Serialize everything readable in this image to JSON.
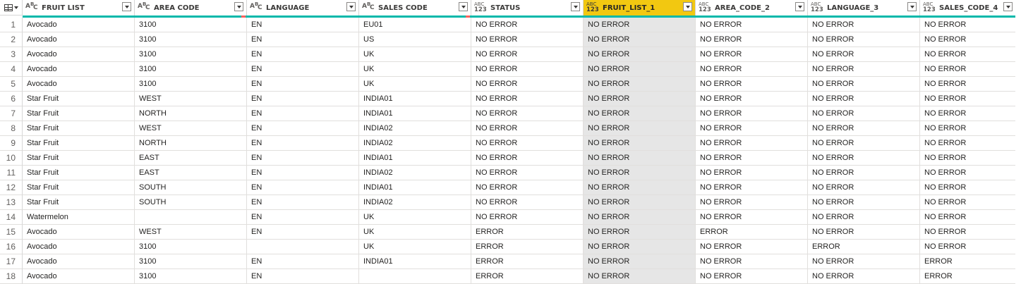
{
  "columns": [
    {
      "name": "FRUIT LIST",
      "type": "abc"
    },
    {
      "name": "AREA CODE",
      "type": "abc"
    },
    {
      "name": "LANGUAGE",
      "type": "abc"
    },
    {
      "name": "SALES CODE",
      "type": "abc"
    },
    {
      "name": "STATUS",
      "type": "any"
    },
    {
      "name": "FRUIT_LIST_1",
      "type": "any",
      "selected": true
    },
    {
      "name": "AREA_CODE_2",
      "type": "any"
    },
    {
      "name": "LANGUAGE_3",
      "type": "any"
    },
    {
      "name": "SALES_CODE_4",
      "type": "any"
    }
  ],
  "type_icons": {
    "abc": [
      "A",
      "B",
      "C"
    ],
    "any": [
      "ABC",
      "123"
    ]
  },
  "quality_error_columns": [
    1,
    3
  ],
  "colors": {
    "quality_bar": "#01b8aa",
    "quality_error": "#fd625e",
    "selected_header": "#f2c811",
    "selected_column": "#e6e6e6"
  },
  "rows": [
    {
      "num": "1",
      "cells": [
        "Avocado",
        "3100",
        "EN",
        "EU01",
        "NO ERROR",
        "NO ERROR",
        "NO ERROR",
        "NO ERROR",
        "NO ERROR"
      ]
    },
    {
      "num": "2",
      "cells": [
        "Avocado",
        "3100",
        "EN",
        "US",
        "NO ERROR",
        "NO ERROR",
        "NO ERROR",
        "NO ERROR",
        "NO ERROR"
      ]
    },
    {
      "num": "3",
      "cells": [
        "Avocado",
        "3100",
        "EN",
        "UK",
        "NO ERROR",
        "NO ERROR",
        "NO ERROR",
        "NO ERROR",
        "NO ERROR"
      ]
    },
    {
      "num": "4",
      "cells": [
        "Avocado",
        "3100",
        "EN",
        "UK",
        "NO ERROR",
        "NO ERROR",
        "NO ERROR",
        "NO ERROR",
        "NO ERROR"
      ]
    },
    {
      "num": "5",
      "cells": [
        "Avocado",
        "3100",
        "EN",
        "UK",
        "NO ERROR",
        "NO ERROR",
        "NO ERROR",
        "NO ERROR",
        "NO ERROR"
      ]
    },
    {
      "num": "6",
      "cells": [
        "Star Fruit",
        "WEST",
        "EN",
        "INDIA01",
        "NO ERROR",
        "NO ERROR",
        "NO ERROR",
        "NO ERROR",
        "NO ERROR"
      ]
    },
    {
      "num": "7",
      "cells": [
        "Star Fruit",
        "NORTH",
        "EN",
        "INDIA01",
        "NO ERROR",
        "NO ERROR",
        "NO ERROR",
        "NO ERROR",
        "NO ERROR"
      ]
    },
    {
      "num": "8",
      "cells": [
        "Star Fruit",
        "WEST",
        "EN",
        "INDIA02",
        "NO ERROR",
        "NO ERROR",
        "NO ERROR",
        "NO ERROR",
        "NO ERROR"
      ]
    },
    {
      "num": "9",
      "cells": [
        "Star Fruit",
        "NORTH",
        "EN",
        "INDIA02",
        "NO ERROR",
        "NO ERROR",
        "NO ERROR",
        "NO ERROR",
        "NO ERROR"
      ]
    },
    {
      "num": "10",
      "cells": [
        "Star Fruit",
        "EAST",
        "EN",
        "INDIA01",
        "NO ERROR",
        "NO ERROR",
        "NO ERROR",
        "NO ERROR",
        "NO ERROR"
      ]
    },
    {
      "num": "11",
      "cells": [
        "Star Fruit",
        "EAST",
        "EN",
        "INDIA02",
        "NO ERROR",
        "NO ERROR",
        "NO ERROR",
        "NO ERROR",
        "NO ERROR"
      ]
    },
    {
      "num": "12",
      "cells": [
        "Star Fruit",
        "SOUTH",
        "EN",
        "INDIA01",
        "NO ERROR",
        "NO ERROR",
        "NO ERROR",
        "NO ERROR",
        "NO ERROR"
      ]
    },
    {
      "num": "13",
      "cells": [
        "Star Fruit",
        "SOUTH",
        "EN",
        "INDIA02",
        "NO ERROR",
        "NO ERROR",
        "NO ERROR",
        "NO ERROR",
        "NO ERROR"
      ]
    },
    {
      "num": "14",
      "cells": [
        "Watermelon",
        "",
        "EN",
        "UK",
        "NO ERROR",
        "NO ERROR",
        "NO ERROR",
        "NO ERROR",
        "NO ERROR"
      ]
    },
    {
      "num": "15",
      "cells": [
        "Avocado",
        "WEST",
        "EN",
        "UK",
        "ERROR",
        "NO ERROR",
        "ERROR",
        "NO ERROR",
        "NO ERROR"
      ]
    },
    {
      "num": "16",
      "cells": [
        "Avocado",
        "3100",
        "",
        "UK",
        "ERROR",
        "NO ERROR",
        "NO ERROR",
        "ERROR",
        "NO ERROR"
      ]
    },
    {
      "num": "17",
      "cells": [
        "Avocado",
        "3100",
        "EN",
        "INDIA01",
        "ERROR",
        "NO ERROR",
        "NO ERROR",
        "NO ERROR",
        "ERROR"
      ]
    },
    {
      "num": "18",
      "cells": [
        "Avocado",
        "3100",
        "EN",
        "",
        "ERROR",
        "NO ERROR",
        "NO ERROR",
        "NO ERROR",
        "ERROR"
      ]
    }
  ]
}
